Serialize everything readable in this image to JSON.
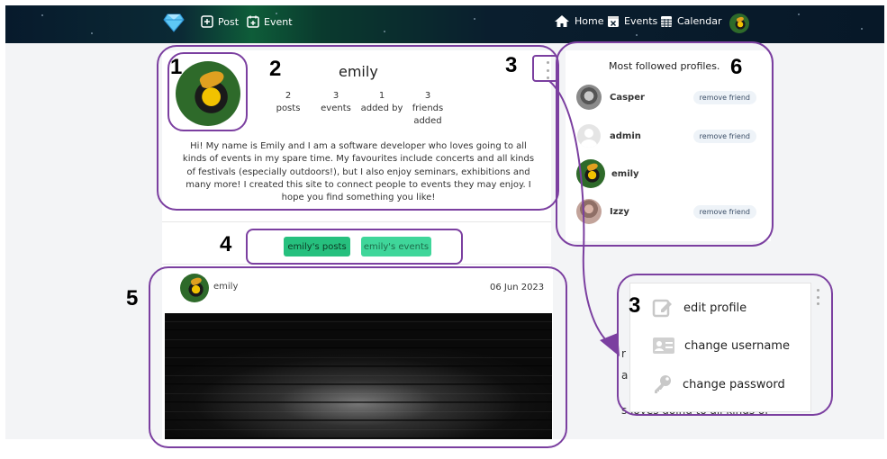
{
  "navbar": {
    "left_items": [
      {
        "label": "Post",
        "icon": "plus-square-icon"
      },
      {
        "label": "Event",
        "icon": "calendar-plus-icon"
      }
    ],
    "right_items": [
      {
        "label": "Home",
        "icon": "home-icon"
      },
      {
        "label": "Events",
        "icon": "calendar-x-icon"
      },
      {
        "label": "Calendar",
        "icon": "calendar-grid-icon"
      }
    ],
    "logo_icon": "diamond-icon"
  },
  "profile": {
    "username": "emily",
    "stats": [
      {
        "value": "2",
        "label": "posts"
      },
      {
        "value": "3",
        "label": "events"
      },
      {
        "value": "1",
        "label": "added by"
      },
      {
        "value": "3",
        "label": "friends added"
      }
    ],
    "bio": "Hi! My name is Emily and I am a software developer who loves going to all kinds of events in my spare time. My favourites include concerts and all kinds of festivals (especially outdoors!), but I also enjoy seminars, exhibitions and many more! I created this site to connect people to events they may enjoy. I hope you find something you like!"
  },
  "tabs": {
    "posts_label": "emily's posts",
    "events_label": "emily's events"
  },
  "post": {
    "author": "emily",
    "date": "06 Jun 2023"
  },
  "sidebar": {
    "title": "Most followed profiles.",
    "friends": [
      {
        "name": "Casper",
        "action": "remove friend"
      },
      {
        "name": "admin",
        "action": "remove friend"
      },
      {
        "name": "emily",
        "action": ""
      },
      {
        "name": "Izzy",
        "action": "remove friend"
      }
    ]
  },
  "dropdown": {
    "items": [
      {
        "label": "edit profile",
        "icon": "edit-icon"
      },
      {
        "label": "change username",
        "icon": "id-card-icon"
      },
      {
        "label": "change password",
        "icon": "key-icon"
      }
    ],
    "background_fragments": [
      "r",
      "a",
      "s loves going to all kinds of"
    ]
  },
  "annotations": {
    "labels": [
      "1",
      "2",
      "3",
      "4",
      "5",
      "6",
      "3"
    ],
    "color": "#7b3fa0"
  },
  "colors": {
    "accent_green": "#2fcf8a",
    "navbar_dark": "#071a2c"
  }
}
